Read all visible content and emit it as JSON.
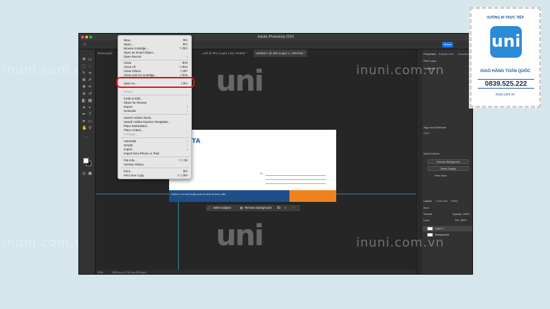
{
  "app": {
    "window_title": "Adobe Photoshop 2024",
    "share_label": "Share"
  },
  "tabs": [
    {
      "label": "banner.psd"
    },
    {
      "label": "...yed @ 29% (Layer 1 (5), RGB/8) *"
    },
    {
      "label": "Untitled-1 @ 33% (Layer 1, CMYK/8) *"
    }
  ],
  "file_menu": {
    "items": [
      {
        "label": "New...",
        "shortcut": "⌘N"
      },
      {
        "label": "Open...",
        "shortcut": "⌘O"
      },
      {
        "label": "Browse in Bridge...",
        "shortcut": "⌥⌘O"
      },
      {
        "label": "Open as Smart Object...",
        "shortcut": ""
      },
      {
        "label": "Open Recent",
        "shortcut": "›"
      },
      {
        "label": "Close",
        "shortcut": "⌘W"
      },
      {
        "label": "Close All",
        "shortcut": "⌥⌘W"
      },
      {
        "label": "Close Others",
        "shortcut": "⌥⌘P"
      },
      {
        "label": "Close and Go to Bridge...",
        "shortcut": "⇧⌘W"
      },
      {
        "label": "Save As...",
        "shortcut": "⇧⌘S"
      },
      {
        "label": "Revert",
        "shortcut": ""
      },
      {
        "label": "Invite to Edit...",
        "shortcut": ""
      },
      {
        "label": "Share for Review",
        "shortcut": ""
      },
      {
        "label": "Export",
        "shortcut": "›"
      },
      {
        "label": "Generate",
        "shortcut": "›"
      },
      {
        "label": "Search Adobe Stock...",
        "shortcut": ""
      },
      {
        "label": "Search Adobe Express Templates...",
        "shortcut": ""
      },
      {
        "label": "Place Embedded...",
        "shortcut": ""
      },
      {
        "label": "Place Linked...",
        "shortcut": ""
      },
      {
        "label": "Package...",
        "shortcut": ""
      },
      {
        "label": "Automate",
        "shortcut": "›"
      },
      {
        "label": "Scripts",
        "shortcut": "›"
      },
      {
        "label": "Import",
        "shortcut": "›"
      },
      {
        "label": "Import from iPhone or iPad",
        "shortcut": ""
      },
      {
        "label": "File Info...",
        "shortcut": "⌥⇧⌘I"
      },
      {
        "label": "Version History",
        "shortcut": ""
      },
      {
        "label": "Print...",
        "shortcut": "⌘P"
      },
      {
        "label": "Print One Copy",
        "shortcut": "⌥⇧⌘P"
      }
    ]
  },
  "contextual_bar": {
    "select_subject": "Select subject",
    "remove_background": "Remove background"
  },
  "status_bar": {
    "zoom": "33%",
    "doc_size": "3850 px x 1700 px (300 ppi)"
  },
  "document": {
    "logo_text": "TA",
    "to_label": "To:",
    "footer_text": "CÔNG TY CP XUẤT NHẬP KHẨU XƯƠNG IN TRỰC TIẾP"
  },
  "panels": {
    "properties_tab": "Properties",
    "adjustments_tab": "Adjustments",
    "libraries_tab": "Libraries",
    "pixel_layer": "Pixel Layer",
    "transform": "Transform",
    "align": "Align and Distribute",
    "align_sub": "Align:",
    "quick_actions": "Quick Actions",
    "remove_bg_btn": "Remove Background",
    "select_subject_btn": "Select Subject",
    "view_more": "View More",
    "layers_tab": "Layers",
    "channels_tab": "Channels",
    "paths_tab": "Paths",
    "kind": "Kind",
    "blend": "Normal",
    "opacity": "Opacity: 100%",
    "lock": "Lock:",
    "fill": "Fill: 100%",
    "layer_1": "Layer 1",
    "background": "Background"
  },
  "watermark": {
    "site": "inuni.com.vn",
    "logo": "uni"
  },
  "stamp": {
    "title": "XƯỞNG IN TRỰC TIẾP",
    "logo": "uni",
    "subtitle": "GIAO HÀNG TOÀN QUỐC",
    "phone": "0839.525.222",
    "website": "inuni.com.vn"
  },
  "colors": {
    "highlight": "#e0141b",
    "accent": "#1473e6",
    "brand_blue": "#2c8ad7"
  }
}
